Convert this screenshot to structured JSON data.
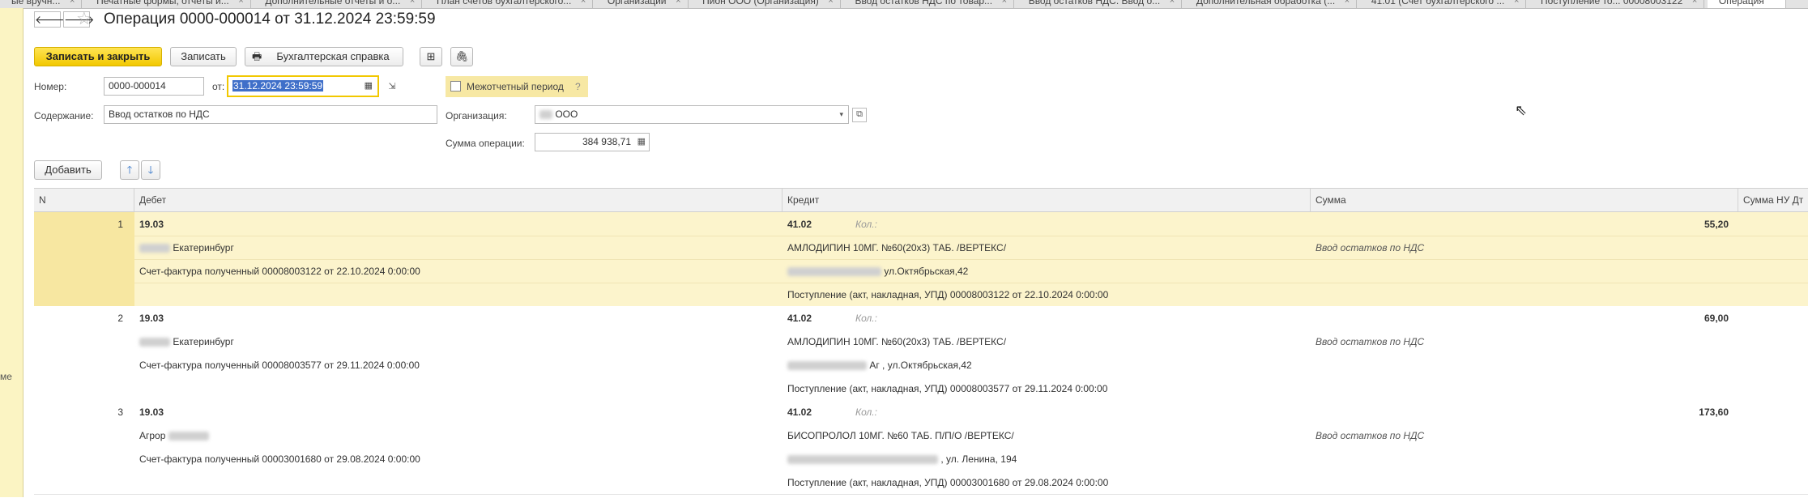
{
  "tabs": [
    {
      "label": "ые вручн..."
    },
    {
      "label": "Печатные формы, отчеты и..."
    },
    {
      "label": "Дополнительные отчеты и о..."
    },
    {
      "label": "План счетов бухгалтерского..."
    },
    {
      "label": "Организации"
    },
    {
      "label": "Пион ООО (Организация)"
    },
    {
      "label": "Ввод остатков НДС по товар..."
    },
    {
      "label": "Ввод остатков НДС. Ввод о..."
    },
    {
      "label": "Дополнительная обработка (..."
    },
    {
      "label": "41.01 (Счет бухгалтерского ..."
    },
    {
      "label": "Поступление то... 00008003122"
    },
    {
      "label": "Операция"
    }
  ],
  "left_panel": {
    "label": "ме"
  },
  "header": {
    "title": "Операция 0000-000014 от 31.12.2024 23:59:59",
    "back": "🡐",
    "forward": "🡒"
  },
  "toolbar": {
    "save_close": "Записать и закрыть",
    "save": "Записать",
    "report": "Бухгалтерская справка"
  },
  "form": {
    "number_label": "Номер:",
    "number_value": "0000-000014",
    "date_label": "от:",
    "date_value": "31.12.2024 23:59:59",
    "interperiod_label": "Межотчетный период",
    "help": "?",
    "content_label": "Содержание:",
    "content_value": "Ввод остатков по НДС",
    "org_label": "Организация:",
    "org_value": "ООО",
    "sum_label": "Сумма операции:",
    "sum_value": "384 938,71"
  },
  "table_toolbar": {
    "add": "Добавить"
  },
  "table": {
    "columns": [
      "N",
      "Дебет",
      "Кредит",
      "Сумма",
      "Сумма НУ Дт"
    ],
    "rows": [
      {
        "n": "1",
        "debit_account": "19.03",
        "debit_sub1": "Екатеринбург",
        "debit_sub2": "Счет-фактура полученный 00008003122 от 22.10.2024 0:00:00",
        "credit_account": "41.02",
        "qty_label": "Кол.:",
        "credit_sub1": "АМЛОДИПИН 10МГ. №60(20x3) ТАБ. /ВЕРТЕКС/",
        "credit_sub2": "ул.Октябрьская,42",
        "credit_sub3": "Поступление (акт, накладная, УПД) 00008003122 от 22.10.2024 0:00:00",
        "amount": "55,20",
        "description": "Ввод остатков по НДС"
      },
      {
        "n": "2",
        "debit_account": "19.03",
        "debit_sub1": "Екатеринбург",
        "debit_sub2": "Счет-фактура полученный 00008003577 от 29.11.2024 0:00:00",
        "credit_account": "41.02",
        "qty_label": "Кол.:",
        "credit_sub1": "АМЛОДИПИН 10МГ. №60(20x3) ТАБ. /ВЕРТЕКС/",
        "credit_sub2": "Аг , ул.Октябрьская,42",
        "credit_sub3": "Поступление (акт, накладная, УПД) 00008003577 от 29.11.2024 0:00:00",
        "amount": "69,00",
        "description": "Ввод остатков по НДС"
      },
      {
        "n": "3",
        "debit_account": "19.03",
        "debit_sub1": "Агрор",
        "debit_sub2": "Счет-фактура полученный 00003001680 от 29.08.2024 0:00:00",
        "credit_account": "41.02",
        "qty_label": "Кол.:",
        "credit_sub1": "БИСОПРОЛОЛ 10МГ. №60 ТАБ. П/П/О /ВЕРТЕКС/",
        "credit_sub2": ", ул. Ленина, 194",
        "credit_sub3": "Поступление (акт, накладная, УПД) 00003001680 от 29.08.2024 0:00:00",
        "amount": "173,60",
        "description": "Ввод остатков по НДС"
      }
    ]
  },
  "icons": [
    "star-icon",
    "printer-icon",
    "structure-icon",
    "paperclip-icon",
    "calendar-icon",
    "calculator-icon",
    "arrow-up-icon",
    "arrow-down-icon",
    "open-icon"
  ],
  "colors": {
    "accent_yellow": "#f2c800",
    "selected_row": "#fcf4cc",
    "date_highlight": "#3f6fc9"
  }
}
